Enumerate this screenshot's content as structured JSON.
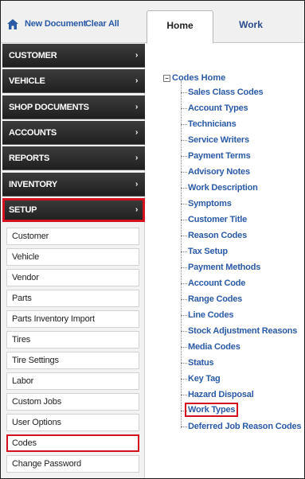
{
  "topbar": {
    "home_icon": "home-icon",
    "new_document": "New Document",
    "clear_all": "Clear All"
  },
  "tabs": [
    {
      "label": "Home",
      "active": true
    },
    {
      "label": "Work",
      "active": false
    }
  ],
  "sidebar": {
    "menu": [
      {
        "label": "CUSTOMER"
      },
      {
        "label": "VEHICLE"
      },
      {
        "label": "SHOP DOCUMENTS"
      },
      {
        "label": "ACCOUNTS"
      },
      {
        "label": "REPORTS"
      },
      {
        "label": "INVENTORY"
      },
      {
        "label": "SETUP",
        "highlighted": true
      }
    ],
    "chevron": "›",
    "submenu": [
      {
        "label": "Customer"
      },
      {
        "label": "Vehicle"
      },
      {
        "label": "Vendor"
      },
      {
        "label": "Parts"
      },
      {
        "label": "Parts Inventory Import"
      },
      {
        "label": "Tires"
      },
      {
        "label": "Tire Settings"
      },
      {
        "label": "Labor"
      },
      {
        "label": "Custom Jobs"
      },
      {
        "label": "User Options"
      },
      {
        "label": "Codes",
        "highlighted": true
      },
      {
        "label": "Change Password"
      }
    ]
  },
  "codes_tree": {
    "toggle": "−",
    "root": "Codes Home",
    "items": [
      {
        "label": "Sales Class Codes"
      },
      {
        "label": "Account Types"
      },
      {
        "label": "Technicians"
      },
      {
        "label": "Service Writers"
      },
      {
        "label": "Payment Terms"
      },
      {
        "label": "Advisory Notes"
      },
      {
        "label": "Work Description"
      },
      {
        "label": "Symptoms"
      },
      {
        "label": "Customer Title"
      },
      {
        "label": "Reason Codes"
      },
      {
        "label": "Tax Setup"
      },
      {
        "label": "Payment Methods"
      },
      {
        "label": "Account Code"
      },
      {
        "label": "Range Codes"
      },
      {
        "label": "Line Codes"
      },
      {
        "label": "Stock Adjustment Reasons"
      },
      {
        "label": "Media Codes"
      },
      {
        "label": "Status"
      },
      {
        "label": "Key Tag"
      },
      {
        "label": "Hazard Disposal"
      },
      {
        "label": "Work Types",
        "highlighted": true
      },
      {
        "label": "Deferred Job Reason Codes"
      }
    ]
  },
  "colors": {
    "link": "#2a5aa6",
    "highlight": "#d4101e",
    "menu_bg": "#2b2b2b"
  }
}
